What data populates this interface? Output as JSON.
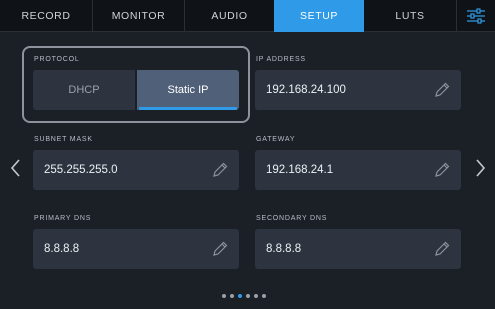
{
  "tabs": [
    {
      "label": "RECORD",
      "active": false
    },
    {
      "label": "MONITOR",
      "active": false
    },
    {
      "label": "AUDIO",
      "active": false
    },
    {
      "label": "SETUP",
      "active": true
    },
    {
      "label": "LUTS",
      "active": false
    }
  ],
  "menu_icon": "sliders-icon",
  "protocol": {
    "label": "PROTOCOL",
    "options": [
      "DHCP",
      "Static IP"
    ],
    "selected": "Static IP"
  },
  "ip_address": {
    "label": "IP ADDRESS",
    "value": "192.168.24.100"
  },
  "subnet_mask": {
    "label": "SUBNET MASK",
    "value": "255.255.255.0"
  },
  "gateway": {
    "label": "GATEWAY",
    "value": "192.168.24.1"
  },
  "primary_dns": {
    "label": "PRIMARY DNS",
    "value": "8.8.8.8"
  },
  "secondary_dns": {
    "label": "SECONDARY DNS",
    "value": "8.8.8.8"
  },
  "pagination": {
    "total_pages": 6,
    "current_page": 3
  },
  "colors": {
    "accent": "#2f9be8",
    "background": "#1b1f26",
    "field": "#2d3440",
    "selected_segment": "#4f6078"
  }
}
